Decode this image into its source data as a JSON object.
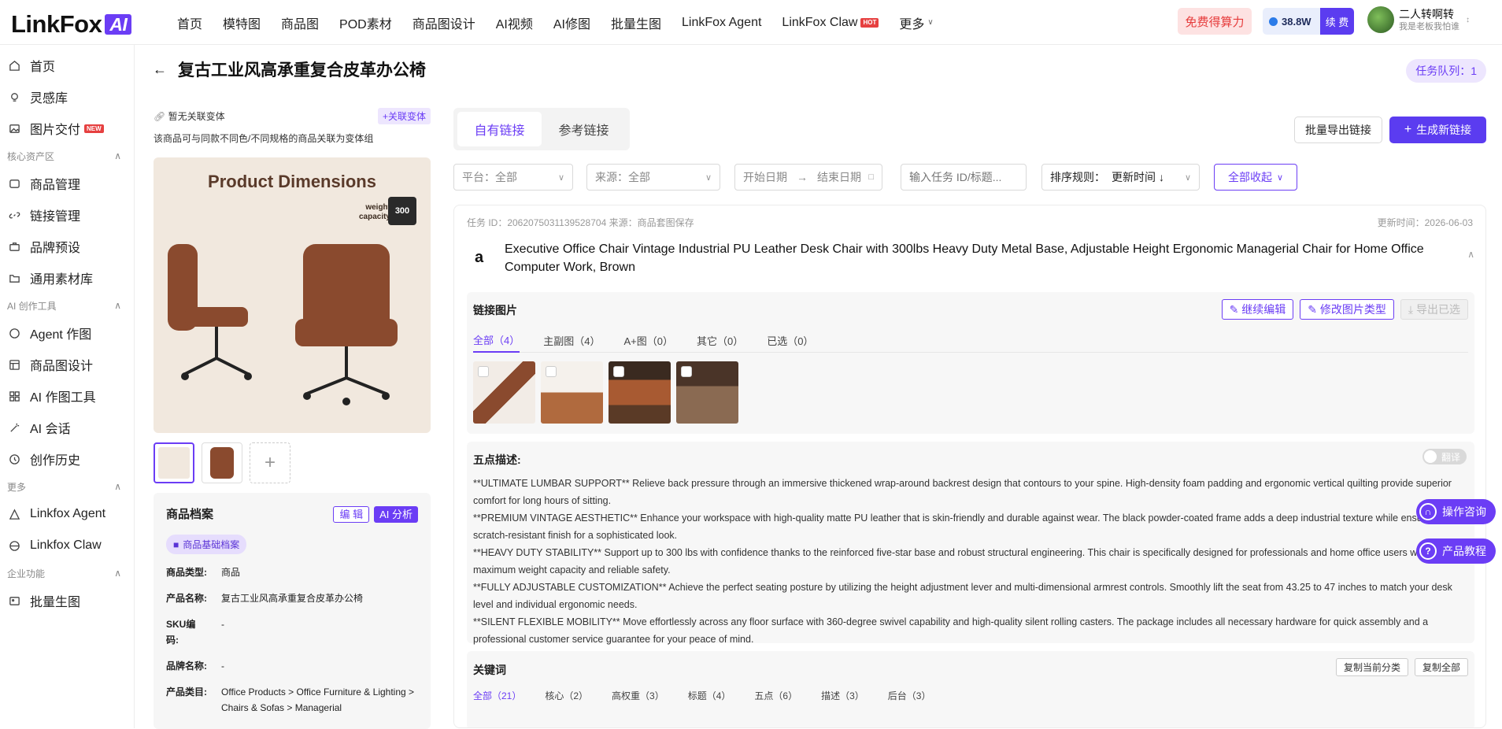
{
  "app": {
    "logo_text": "LinkFox",
    "logo_ai": "AI"
  },
  "nav": [
    "首页",
    "模特图",
    "商品图",
    "POD素材",
    "商品图设计",
    "AI视频",
    "AI修图",
    "批量生图",
    "LinkFox Agent",
    "LinkFox Claw",
    "更多"
  ],
  "nav_hot": "HOT",
  "header": {
    "free_label": "免费得算力",
    "credits": "38.8W",
    "renew_label": "续 费",
    "user_name": "二人转啊转",
    "user_sub": "我是老板我怕谁"
  },
  "sidebar": {
    "top": [
      "首页",
      "灵感库",
      "图片交付"
    ],
    "new_badge": "NEW",
    "sec_assets": "核心资产区",
    "assets": [
      "商品管理",
      "链接管理",
      "品牌预设",
      "通用素材库"
    ],
    "sec_ai": "AI 创作工具",
    "ai": [
      "Agent 作图",
      "商品图设计",
      "AI 作图工具",
      "AI 会话",
      "创作历史"
    ],
    "sec_more": "更多",
    "more": [
      "Linkfox Agent",
      "Linkfox Claw"
    ],
    "sec_ent": "企业功能",
    "ent": [
      "批量生图"
    ]
  },
  "page": {
    "title": "复古工业风高承重复合皮革办公椅",
    "queue": "任务队列：1"
  },
  "left": {
    "no_link": "暂无关联变体",
    "assoc_btn": "+关联变体",
    "hint": "该商品可与同款不同色/不同规格的商品关联为变体组",
    "img_title": "Product Dimensions",
    "img_weight": "weight capacity",
    "img_lbs": "300",
    "card_title": "商品档案",
    "edit": "编 辑",
    "analyze": "AI 分析",
    "tag": "商品基础档案",
    "fields": [
      {
        "k": "商品类型:",
        "v": "商品"
      },
      {
        "k": "产品名称:",
        "v": "复古工业风高承重复合皮革办公椅"
      },
      {
        "k": "SKU编码:",
        "v": "-"
      },
      {
        "k": "品牌名称:",
        "v": "-"
      },
      {
        "k": "产品类目:",
        "v": "Office Products > Office Furniture & Lighting > Chairs & Sofas > Managerial"
      }
    ]
  },
  "right": {
    "tab_own": "自有链接",
    "tab_ref": "参考链接",
    "export_btn": "批量导出链接",
    "gen_btn": "生成新链接",
    "filters": {
      "platform": "平台：全部",
      "source": "来源：全部",
      "start": "开始日期",
      "end": "结束日期",
      "search_ph": "输入任务 ID/标题...",
      "sort_label": "排序规则：",
      "sort_value": "更新时间",
      "collapse": "全部收起"
    },
    "task": {
      "meta": "任务 ID：2062075031139528704   来源：商品套图保存",
      "updated": "更新时间：2026-06-03",
      "title": "Executive Office Chair Vintage Industrial PU Leather Desk Chair with 300lbs Heavy Duty Metal Base, Adjustable Height Ergonomic Managerial Chair for Home Office Computer Work, Brown",
      "img_section": "链接图片",
      "act_edit": "继续编辑",
      "act_type": "修改图片类型",
      "act_export": "导出已选",
      "subtabs": [
        "全部（4）",
        "主副图（4）",
        "A+图（0）",
        "其它（0）",
        "已选（0）"
      ],
      "bullets_title": "五点描述:",
      "translate": "翻译",
      "bullets": [
        "**ULTIMATE LUMBAR SUPPORT** Relieve back pressure through an immersive thickened wrap-around backrest design that contours to your spine. High-density foam padding and ergonomic vertical quilting provide superior comfort for long hours of sitting.",
        "**PREMIUM VINTAGE AESTHETIC** Enhance your workspace with high-quality matte PU leather that is skin-friendly and durable against wear. The black powder-coated frame adds a deep industrial texture while ensuring a scratch-resistant finish for a sophisticated look.",
        "**HEAVY DUTY STABILITY** Support up to 300 lbs with confidence thanks to the reinforced five-star base and robust structural engineering. This chair is specifically designed for professionals and home office users who require maximum weight capacity and reliable safety.",
        "**FULLY ADJUSTABLE CUSTOMIZATION** Achieve the perfect seating posture by utilizing the height adjustment lever and multi-dimensional armrest controls. Smoothly lift the seat from 43.25 to 47 inches to match your desk level and individual ergonomic needs.",
        "**SILENT FLEXIBLE MOBILITY** Move effortlessly across any floor surface with 360-degree swivel capability and high-quality silent rolling casters. The package includes all necessary hardware for quick assembly and a professional customer service guarantee for your peace of mind."
      ],
      "kw_title": "关键词",
      "kw_copy_cur": "复制当前分类",
      "kw_copy_all": "复制全部",
      "kw_tabs": [
        "全部（21）",
        "核心（2）",
        "高权重（3）",
        "标题（4）",
        "五点（6）",
        "描述（3）",
        "后台（3）"
      ]
    }
  },
  "float": {
    "consult": "操作咨询",
    "tutorial": "产品教程"
  }
}
